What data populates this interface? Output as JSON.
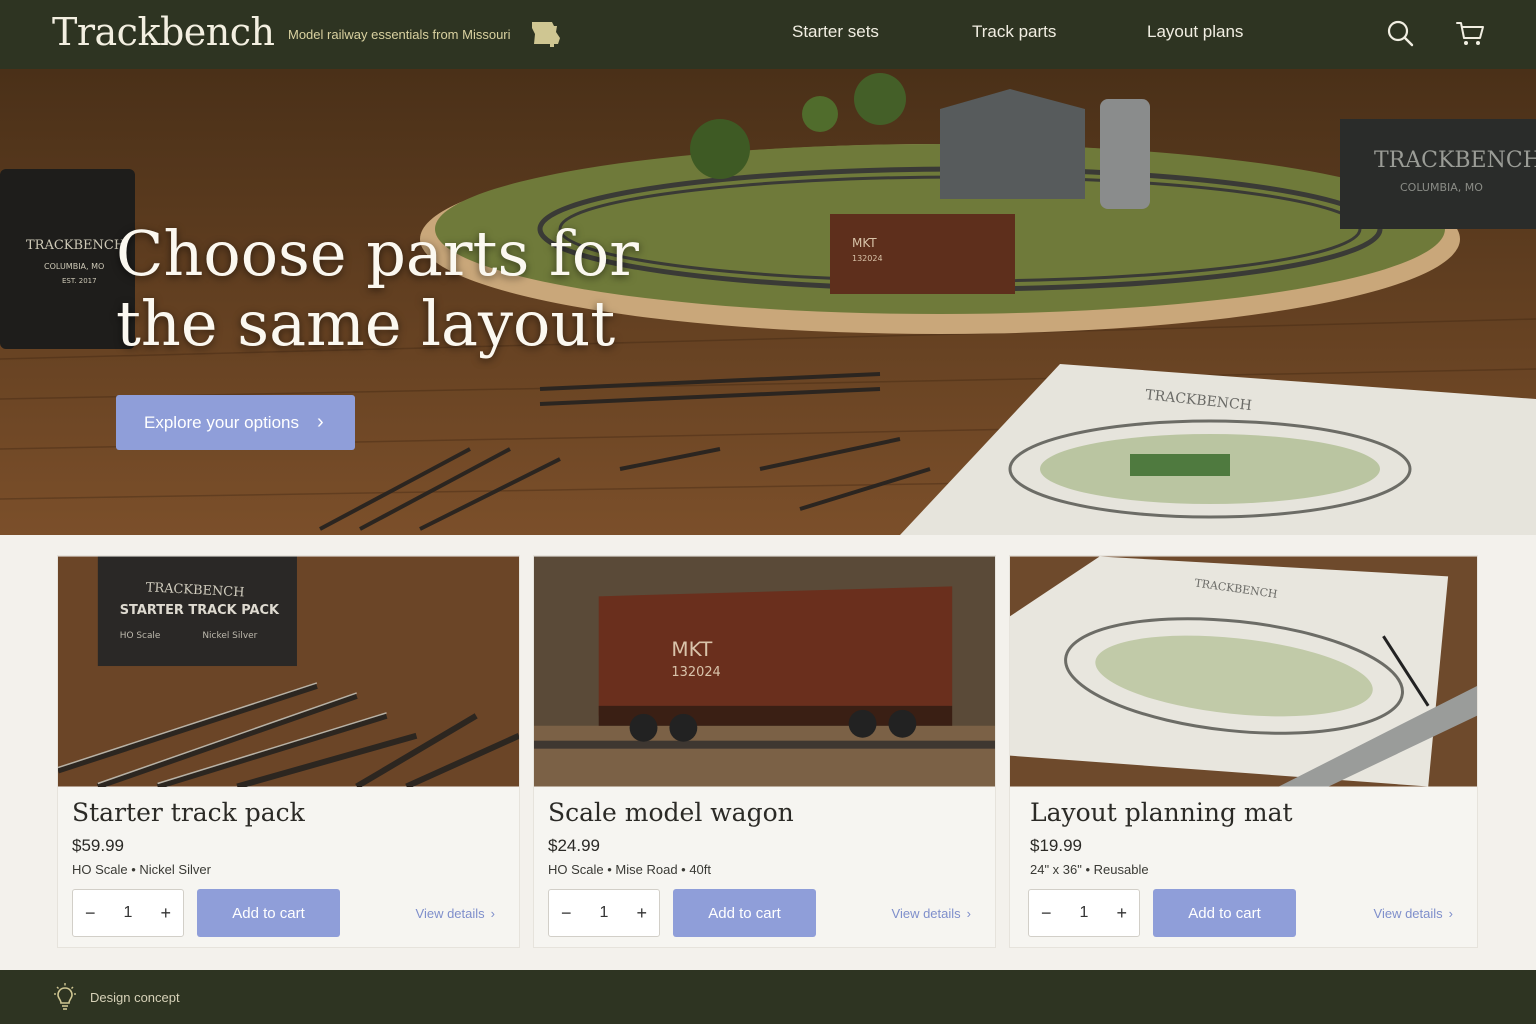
{
  "header": {
    "brand": "Trackbench",
    "tagline": "Model railway essentials from Missouri",
    "state_icon": "missouri-state-icon",
    "nav": [
      "Starter sets",
      "Track parts",
      "Layout plans"
    ],
    "icons": [
      "search-icon",
      "cart-icon"
    ]
  },
  "hero": {
    "title": "Choose parts for the same layout",
    "cta": "Explore your options",
    "mug_text": [
      "TRACKBENCH",
      "COLUMBIA, MO",
      "EST. 2017"
    ],
    "sign_text": [
      "TRACKBENCH",
      "COLUMBIA, MO"
    ],
    "wagon_text": [
      "MKT",
      "132024"
    ],
    "plan_text": "TRACKBENCH"
  },
  "products": [
    {
      "title": "Starter track pack",
      "price": "$59.99",
      "specs": "HO Scale • Nickel Silver",
      "qty": "1",
      "add": "Add to cart",
      "details": "View details",
      "box_text": [
        "TRACKBENCH",
        "STARTER TRACK PACK",
        "HO Scale",
        "Nickel Silver"
      ]
    },
    {
      "title": "Scale model wagon",
      "price": "$24.99",
      "specs": "HO Scale • Mise Road • 40ft",
      "qty": "1",
      "add": "Add to cart",
      "details": "View details",
      "wagon_text": [
        "MKT",
        "132024"
      ]
    },
    {
      "title": "Layout planning mat",
      "price": "$19.99",
      "specs": "24\" x 36\" • Reusable",
      "qty": "1",
      "add": "Add to cart",
      "details": "View details",
      "mat_text": "TRACKBENCH"
    }
  ],
  "footer": {
    "label": "Design concept",
    "icon": "lightbulb-icon"
  },
  "colors": {
    "header_bg": "#2e3422",
    "accent_button": "#8f9ed9",
    "link": "#7f8fcb",
    "page_bg": "#f3f1ec"
  }
}
